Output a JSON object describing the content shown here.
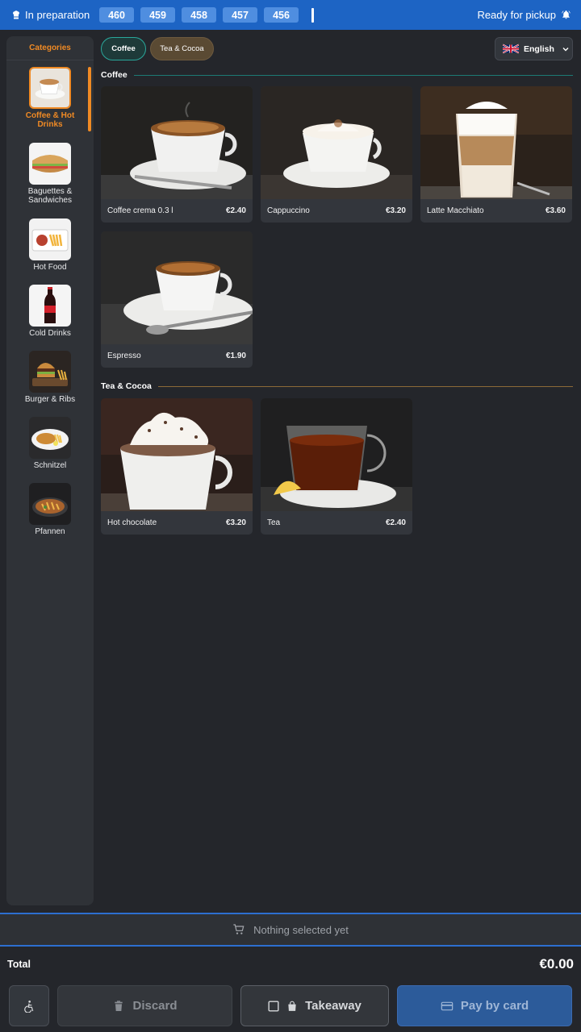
{
  "topbar": {
    "in_preparation": "In preparation",
    "orders": [
      "460",
      "459",
      "458",
      "457",
      "456"
    ],
    "ready": "Ready for pickup"
  },
  "sidebar": {
    "title": "Categories",
    "items": [
      {
        "label": "Coffee & Hot Drinks",
        "icon": "coffee-cup-icon"
      },
      {
        "label": "Baguettes & Sandwiches",
        "icon": "sandwich-icon"
      },
      {
        "label": "Hot Food",
        "icon": "hot-food-icon"
      },
      {
        "label": "Cold Drinks",
        "icon": "cola-bottle-icon"
      },
      {
        "label": "Burger & Ribs",
        "icon": "burger-icon"
      },
      {
        "label": "Schnitzel",
        "icon": "schnitzel-icon"
      },
      {
        "label": "Pfannen",
        "icon": "pan-icon"
      }
    ]
  },
  "chips": {
    "coffee": "Coffee",
    "tea": "Tea & Cocoa"
  },
  "language": {
    "label": "English",
    "flag": "uk-flag-icon"
  },
  "sections": {
    "coffee": {
      "title": "Coffee",
      "items": [
        {
          "name": "Coffee crema 0.3 l",
          "price": "€2.40"
        },
        {
          "name": "Cappuccino",
          "price": "€3.20"
        },
        {
          "name": "Latte Macchiato",
          "price": "€3.60"
        },
        {
          "name": "Espresso",
          "price": "€1.90"
        }
      ]
    },
    "tea": {
      "title": "Tea & Cocoa",
      "items": [
        {
          "name": "Hot chocolate",
          "price": "€3.20"
        },
        {
          "name": "Tea",
          "price": "€2.40"
        }
      ]
    }
  },
  "cart": {
    "empty": "Nothing selected yet"
  },
  "total": {
    "label": "Total",
    "value": "€0.00"
  },
  "actions": {
    "discard": "Discard",
    "takeaway": "Takeaway",
    "pay": "Pay by card"
  },
  "colors": {
    "accent": "#f08a24",
    "brand": "#1d64c4",
    "teal": "#2aa79b",
    "background": "#24262b"
  }
}
